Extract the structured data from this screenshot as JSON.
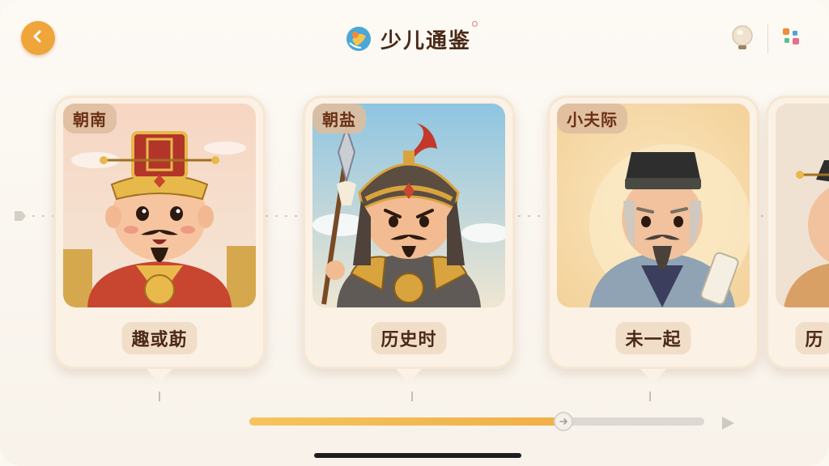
{
  "header": {
    "title": "少儿通鉴",
    "back_icon": "chevron-left-icon",
    "right_icons": [
      "lamp-icon",
      "apps-grid-icon"
    ],
    "accent_color": "#f0a53a"
  },
  "cards": [
    {
      "badge": "朝南",
      "name": "趣或莇",
      "character": "emperor"
    },
    {
      "badge": "朝盐",
      "name": "历史时",
      "character": "general"
    },
    {
      "badge": "小夫际",
      "name": "未一起",
      "character": "scholar"
    },
    {
      "badge": "",
      "name": "历",
      "character": "official"
    }
  ],
  "progress": {
    "value": 0.69,
    "play_icon": "play-icon"
  }
}
